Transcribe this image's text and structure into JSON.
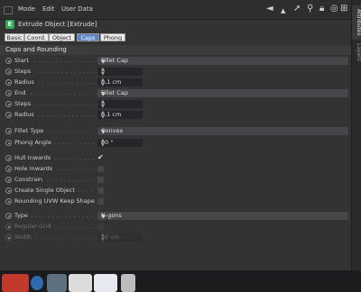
{
  "menu": [
    "Mode",
    "Edit",
    "User Data"
  ],
  "title": "Extrude Object [Extrude]",
  "tabs": [
    "Basic",
    "Coord.",
    "Object",
    "Caps",
    "Phong"
  ],
  "active_tab": "Caps",
  "section": "Caps and Rounding",
  "rows": [
    {
      "label": "Start",
      "type": "dropdown",
      "value": "Fillet Cap"
    },
    {
      "label": "Steps",
      "type": "number",
      "value": "3"
    },
    {
      "label": "Radius",
      "type": "number",
      "value": "0,1 cm"
    },
    {
      "label": "End",
      "type": "dropdown",
      "value": "Fillet Cap"
    },
    {
      "label": "Steps",
      "type": "number",
      "value": "3"
    },
    {
      "label": "Radius",
      "type": "number",
      "value": "0,1 cm"
    },
    {
      "label": "Fillet Type",
      "type": "dropdown",
      "value": "Convex"
    },
    {
      "label": "Phong Angle",
      "type": "number",
      "value": "60 °"
    },
    {
      "label": "Hull Inwards",
      "type": "checkbox",
      "checked": true
    },
    {
      "label": "Hole Inwards",
      "type": "checkbox",
      "checked": false
    },
    {
      "label": "Constrain",
      "type": "checkbox",
      "checked": false
    },
    {
      "label": "Create Single Object",
      "type": "checkbox",
      "checked": false
    },
    {
      "label": "Rounding UVW Keep Shape",
      "type": "checkbox",
      "checked": false
    },
    {
      "label": "Type",
      "type": "dropdown",
      "value": "N-gons"
    },
    {
      "label": "Regular Grid",
      "type": "checkbox",
      "checked": false,
      "disabled": true
    },
    {
      "label": "Width",
      "type": "number",
      "value": "10 cm",
      "disabled": true
    }
  ],
  "side_tabs": [
    "Attributes",
    "Layers"
  ],
  "colors": {
    "accent_tab": "#5a85c8",
    "object_icon": "#2dad5a",
    "panel": "#333334"
  }
}
